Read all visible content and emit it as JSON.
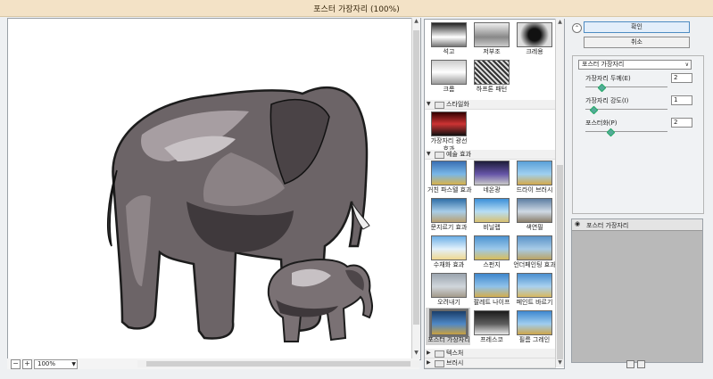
{
  "window": {
    "title": "포스터 가장자리 (100%)"
  },
  "preview": {
    "zoom": "100%",
    "zoom_out_label": "−",
    "zoom_in_label": "+"
  },
  "gallery": {
    "top_row1": [
      {
        "label": "석고"
      },
      {
        "label": "저부조"
      },
      {
        "label": "크레용"
      }
    ],
    "top_row2": [
      {
        "label": "크롬"
      },
      {
        "label": "하프톤 패턴"
      }
    ],
    "categories": {
      "stylize": "스타일화",
      "artistic": "예술 효과",
      "texture": "텍스처",
      "brush": "브러시"
    },
    "stylize_items": [
      {
        "label1": "가장자리 광선",
        "label2": "효과"
      }
    ],
    "artistic_items": [
      {
        "label": "거친 파스텔 효과"
      },
      {
        "label": "네온광"
      },
      {
        "label": "드라이 브러시"
      },
      {
        "label": "문지르기 효과"
      },
      {
        "label": "비닐랩"
      },
      {
        "label": "색연필"
      },
      {
        "label": "수채화 효과"
      },
      {
        "label": "스펀지"
      },
      {
        "label": "언더페인팅 효과"
      },
      {
        "label": "오려내기"
      },
      {
        "label": "팔레트 나이프"
      },
      {
        "label": "페인트 바르기"
      },
      {
        "label": "포스터 가장자리",
        "selected": true
      },
      {
        "label": "프레스코"
      },
      {
        "label": "필름 그레인"
      }
    ]
  },
  "panel": {
    "ok_label": "확인",
    "cancel_label": "취소",
    "filter_select": "포스터 가장자리",
    "params": [
      {
        "label": "가장자리 두께(E)",
        "value": "2",
        "level": 0.2
      },
      {
        "label": "가장자리 강도(I)",
        "value": "1",
        "level": 0.1
      },
      {
        "label": "포스터화(P)",
        "value": "2",
        "level": 0.3
      }
    ],
    "layer_name": "포스터 가장자리"
  },
  "colors": {
    "accent": "#4e8cc2",
    "title_bg": "#f3e2c6"
  }
}
